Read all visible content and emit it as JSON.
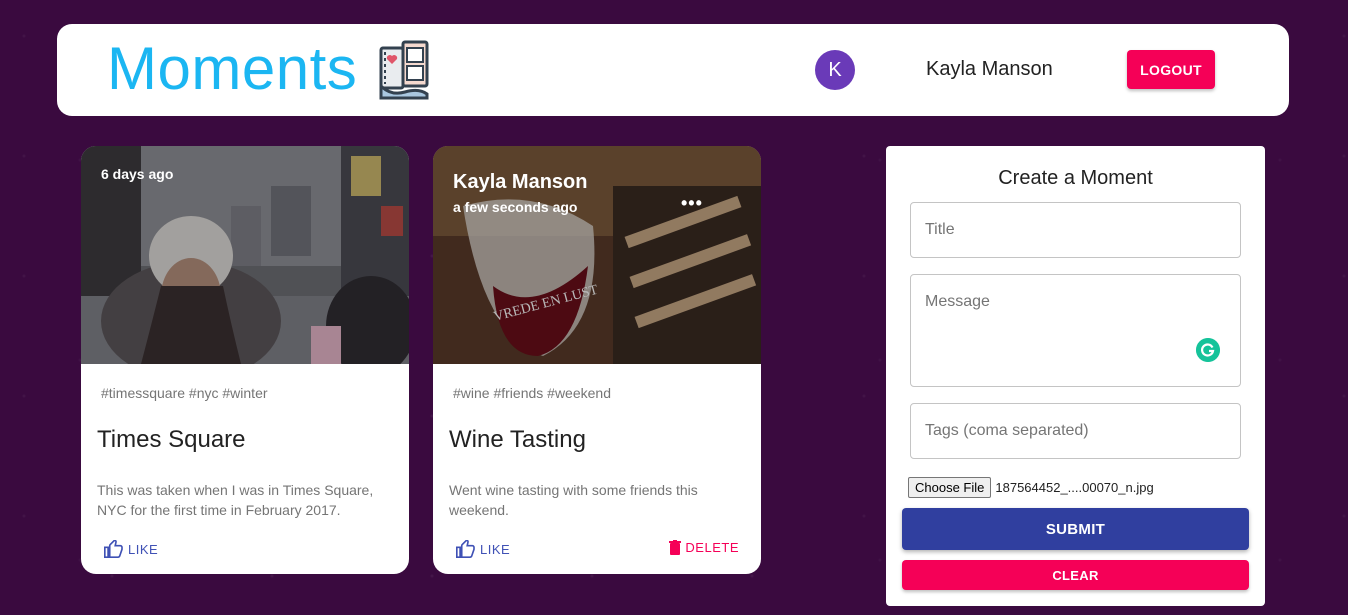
{
  "header": {
    "title": "Moments",
    "logo_icon": "film-reel-heart-icon",
    "avatar_letter": "K",
    "avatar_color": "#6a3ab8",
    "user_name": "Kayla Manson",
    "logout_label": "LOGOUT"
  },
  "posts": [
    {
      "time": "6 days ago",
      "tags": "#timessquare #nyc #winter",
      "title": "Times Square",
      "message": "This was taken when I was in Times Square, NYC for the first time in February 2017.",
      "like_label": "LIKE"
    },
    {
      "author": "Kayla Manson",
      "time": "a few seconds ago",
      "more": "•••",
      "tags": "#wine #friends #weekend",
      "title": "Wine Tasting",
      "message": "Went wine tasting with some friends this weekend.",
      "like_label": "LIKE",
      "delete_label": "DELETE"
    }
  ],
  "form": {
    "title": "Create a Moment",
    "title_placeholder": "Title",
    "message_placeholder": "Message",
    "tags_placeholder": "Tags (coma separated)",
    "file_button": "Choose File",
    "file_name": "187564452_....00070_n.jpg",
    "submit_label": "SUBMIT",
    "clear_label": "CLEAR"
  },
  "colors": {
    "background": "#3a0a3f",
    "brand": "#1bb6f2",
    "primary": "#303f9f",
    "secondary": "#f50057"
  }
}
